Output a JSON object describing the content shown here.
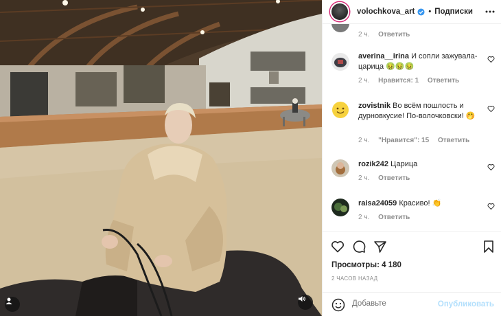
{
  "header": {
    "username": "volochkova_art",
    "separator": "•",
    "follow_label": "Подписки",
    "verified_icon": "verified-badge-icon",
    "more_icon": "more-options-icon"
  },
  "top_comment": {
    "age": "2 ч.",
    "reply": "Ответить"
  },
  "comments": [
    {
      "username": "averina__irina",
      "text": "И сопли зажувала- царица 🤢🤢🤢",
      "age": "2 ч.",
      "likes": "Нравится: 1",
      "reply": "Ответить"
    },
    {
      "username": "zovistnik",
      "text": "Во всём пошлость и дурновкусие! По-волочковски! 🤭",
      "age": "2 ч.",
      "likes": "\"Нравится\": 15",
      "reply": "Ответить"
    },
    {
      "username": "rozik242",
      "text": "Царица",
      "age": "2 ч.",
      "reply": "Ответить"
    },
    {
      "username": "raisa24059",
      "text": "Красиво! 👏",
      "age": "2 ч.",
      "reply": "Ответить"
    }
  ],
  "stats": {
    "views": "Просмотры: 4 180",
    "posted": "2 ЧАСОВ НАЗАД"
  },
  "add_comment": {
    "placeholder": "Добавьте",
    "publish_label": "Опубликовать"
  },
  "colors": {
    "publish_disabled": "#b2dffc",
    "muted_text": "#8e8e8e",
    "primary_text": "#262626",
    "story_ring": "#d62976"
  }
}
